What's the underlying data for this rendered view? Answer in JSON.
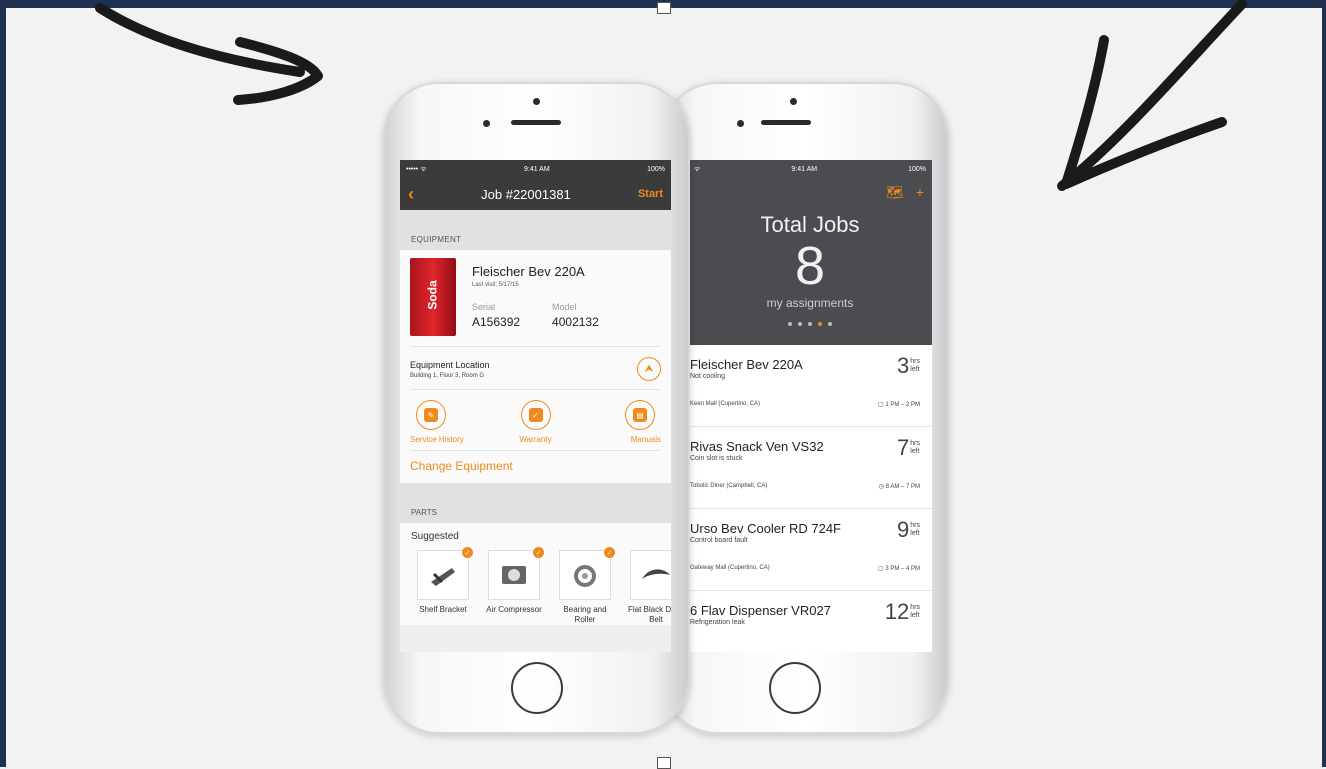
{
  "left_phone": {
    "status": {
      "carrier": "••••• ᯤ",
      "time": "9:41 AM",
      "battery": "100%"
    },
    "nav": {
      "back": "‹",
      "title": "Job #22001381",
      "start": "Start"
    },
    "equipment_header": "EQUIPMENT",
    "equipment": {
      "image_text": "Soda",
      "name": "Fleischer Bev 220A",
      "last_visit": "Last visit: 5/17/15",
      "serial_label": "Serial",
      "serial_value": "A156392",
      "model_label": "Model",
      "model_value": "4002132"
    },
    "location": {
      "title": "Equipment Location",
      "sub": "Building 1, Floor 3, Room G"
    },
    "actions": [
      {
        "label": "Service History",
        "icon": "wrench-icon"
      },
      {
        "label": "Warranty",
        "icon": "shield-icon"
      },
      {
        "label": "Manuals",
        "icon": "book-icon"
      }
    ],
    "change_equipment": "Change Equipment",
    "parts_header": "PARTS",
    "suggested": "Suggested",
    "parts": [
      {
        "label": "Shelf Bracket"
      },
      {
        "label": "Air Compressor"
      },
      {
        "label": "Bearing and Roller"
      },
      {
        "label": "Flat Black Drive Belt"
      }
    ]
  },
  "right_phone": {
    "status": {
      "signal": "ᯤ",
      "time": "9:41 AM",
      "battery": "100%"
    },
    "total_jobs_label": "Total Jobs",
    "total_jobs_count": "8",
    "assignments": "my assignments",
    "jobs": [
      {
        "title": "Fleischer Bev 220A",
        "sub": "Not cooling",
        "loc": "Keen Mall (Cupertino, CA)",
        "time": "▢ 1 PM – 2 PM",
        "hrs": "3"
      },
      {
        "title": "Rivas Snack Ven VS32",
        "sub": "Coin slot is stuck",
        "loc": "Tobolic Diner (Campbell, CA)",
        "time": "◷ 8 AM – 7 PM",
        "hrs": "7"
      },
      {
        "title": "Urso Bev Cooler RD 724F",
        "sub": "Control board fault",
        "loc": "Gateway Mall (Cupertino, CA)",
        "time": "▢ 3 PM – 4 PM",
        "hrs": "9"
      },
      {
        "title": "6 Flav Dispenser VR027",
        "sub": "Refrigeration leak",
        "loc": "",
        "time": "",
        "hrs": "12"
      }
    ],
    "hrs_unit_top": "hrs",
    "hrs_unit_bottom": "left"
  }
}
